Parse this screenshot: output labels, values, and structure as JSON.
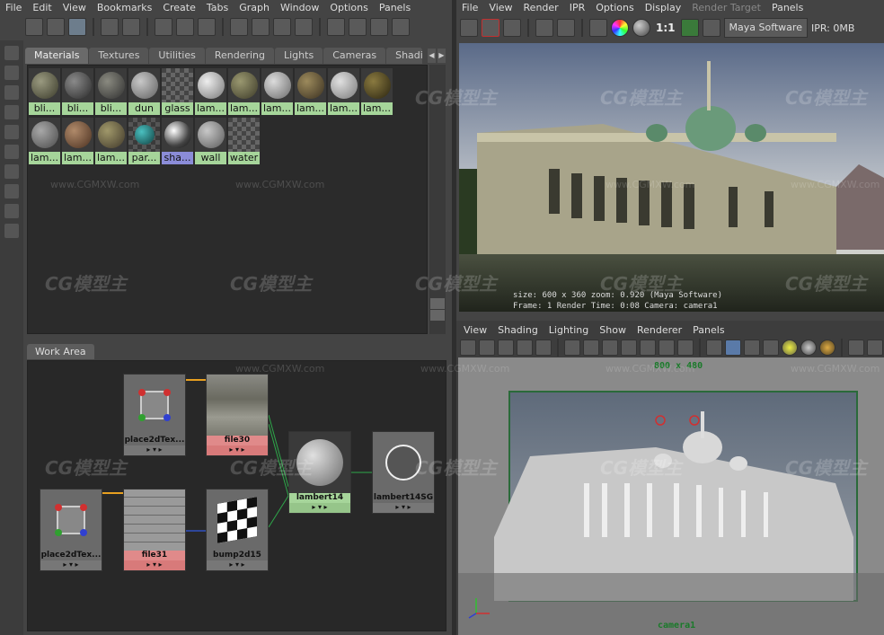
{
  "left_menu": [
    "File",
    "Edit",
    "View",
    "Bookmarks",
    "Create",
    "Tabs",
    "Graph",
    "Window",
    "Options",
    "Panels"
  ],
  "right_menu": [
    "File",
    "View",
    "Render",
    "IPR",
    "Options",
    "Display",
    "Render Target",
    "Panels"
  ],
  "render_toolbar": {
    "ratio_label": "1:1",
    "renderer": "Maya Software",
    "ipr_label": "IPR: 0MB"
  },
  "tabs": [
    "Materials",
    "Textures",
    "Utilities",
    "Rendering",
    "Lights",
    "Cameras",
    "Shading Groups"
  ],
  "materials_row1": [
    "bli...",
    "bli...",
    "bli...",
    "dun",
    "glass",
    "lam...",
    "lam...",
    "lam...",
    "lam...",
    "lam...",
    "lam..."
  ],
  "materials_row2": [
    "lam...",
    "lam...",
    "lam...",
    "par...",
    "sha...",
    "wall",
    "water"
  ],
  "work_area_tab": "Work Area",
  "nodes": {
    "place2d_a": "place2dTex...",
    "file30": "file30",
    "lambert14": "lambert14",
    "lambert14sg": "lambert14SG",
    "place2d_b": "place2dTex...",
    "file31": "file31",
    "bump": "bump2d15"
  },
  "render_info": {
    "line1": "size: 600 x 360 zoom: 0.920          (Maya Software)",
    "line2": "Frame: 1          Render Time: 0:08        Camera: camera1"
  },
  "viewport_menu": [
    "View",
    "Shading",
    "Lighting",
    "Show",
    "Renderer",
    "Panels"
  ],
  "viewport": {
    "resolution": "800 x 480",
    "camera": "camera1"
  },
  "watermarks": {
    "logo": "CG模型主",
    "url": "www.CGMXW.com"
  },
  "colors": {
    "material_label": "#a6d59a",
    "selected_label": "#8b8cd8",
    "file_label": "#e08a8a",
    "shader_label": "#a6d59a",
    "connection": "#2ea84a",
    "bump_connection": "#3050c0",
    "uv_connection": "#e8a020"
  }
}
